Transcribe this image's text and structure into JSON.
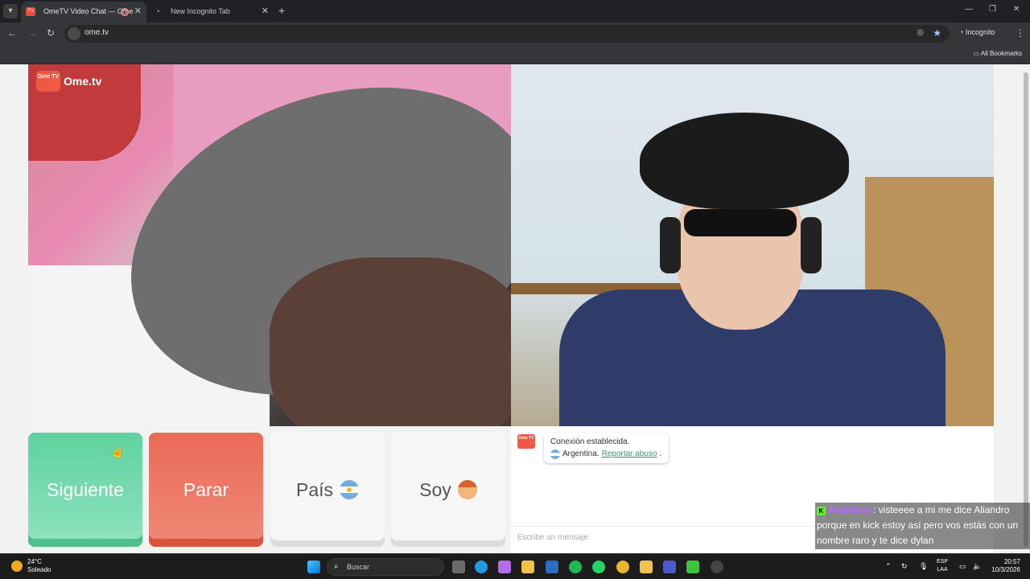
{
  "browser": {
    "tabs": [
      {
        "title": "OmeTV Video Chat — Ome"
      },
      {
        "title": "New Incognito Tab"
      }
    ],
    "url": "ome.tv",
    "incognito_label": "Incognito",
    "all_bookmarks": "All Bookmarks"
  },
  "site": {
    "logo_text": "Ome.tv",
    "badge_text": "Ome TV"
  },
  "controls": {
    "next_label": "Siguiente",
    "stop_label": "Parar",
    "country_label": "País",
    "gender_label": "Soy"
  },
  "chat": {
    "status": "Conexión establecida.",
    "country": "Argentina.",
    "report_link": "Reportar abuso",
    "report_suffix": ".",
    "input_placeholder": "Escribe un mensaje"
  },
  "overlay": {
    "username": "Aliandroo",
    "message": ": visteeee a mi me dice Aliandro porque en kick estoy así pero vos estás con un nombre raro y te dice dylan"
  },
  "taskbar": {
    "temperature": "24°C",
    "weather": "Soleado",
    "search_placeholder": "Buscar",
    "lang_top": "ESP",
    "lang_bottom": "LAA",
    "time": "20:57",
    "date": "10/3/2026"
  },
  "colors": {
    "next": "#5fd2a0",
    "stop": "#ea6b57",
    "brand": "#f05a45",
    "link": "#3a9a78"
  }
}
